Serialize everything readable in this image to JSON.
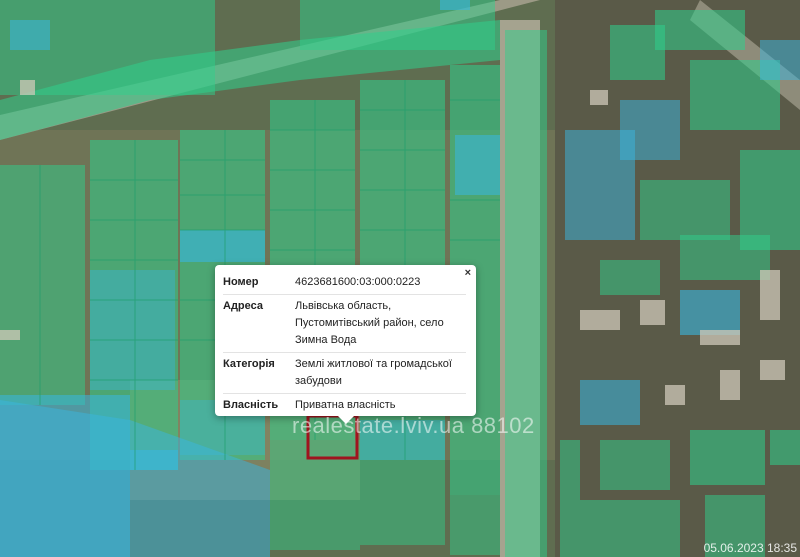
{
  "popup": {
    "close_label": "×",
    "rows": [
      {
        "label": "Номер",
        "value": "4623681600:03:000:0223"
      },
      {
        "label": "Адреса",
        "value": "Львівська область, Пустомитівський район, село Зимна Вода"
      },
      {
        "label": "Категорія",
        "value": "Землі житлової та громадської забудови"
      },
      {
        "label": "Власність",
        "value": "Приватна власність"
      }
    ]
  },
  "watermark": "realestate.lviv.ua 88102",
  "timestamp": "05.06.2023 18:35",
  "colors": {
    "parcel_green": "#2fd08c",
    "parcel_blue": "#39b6e0",
    "selected_parcel": "#a0141e",
    "background": "#5d6b4e"
  }
}
